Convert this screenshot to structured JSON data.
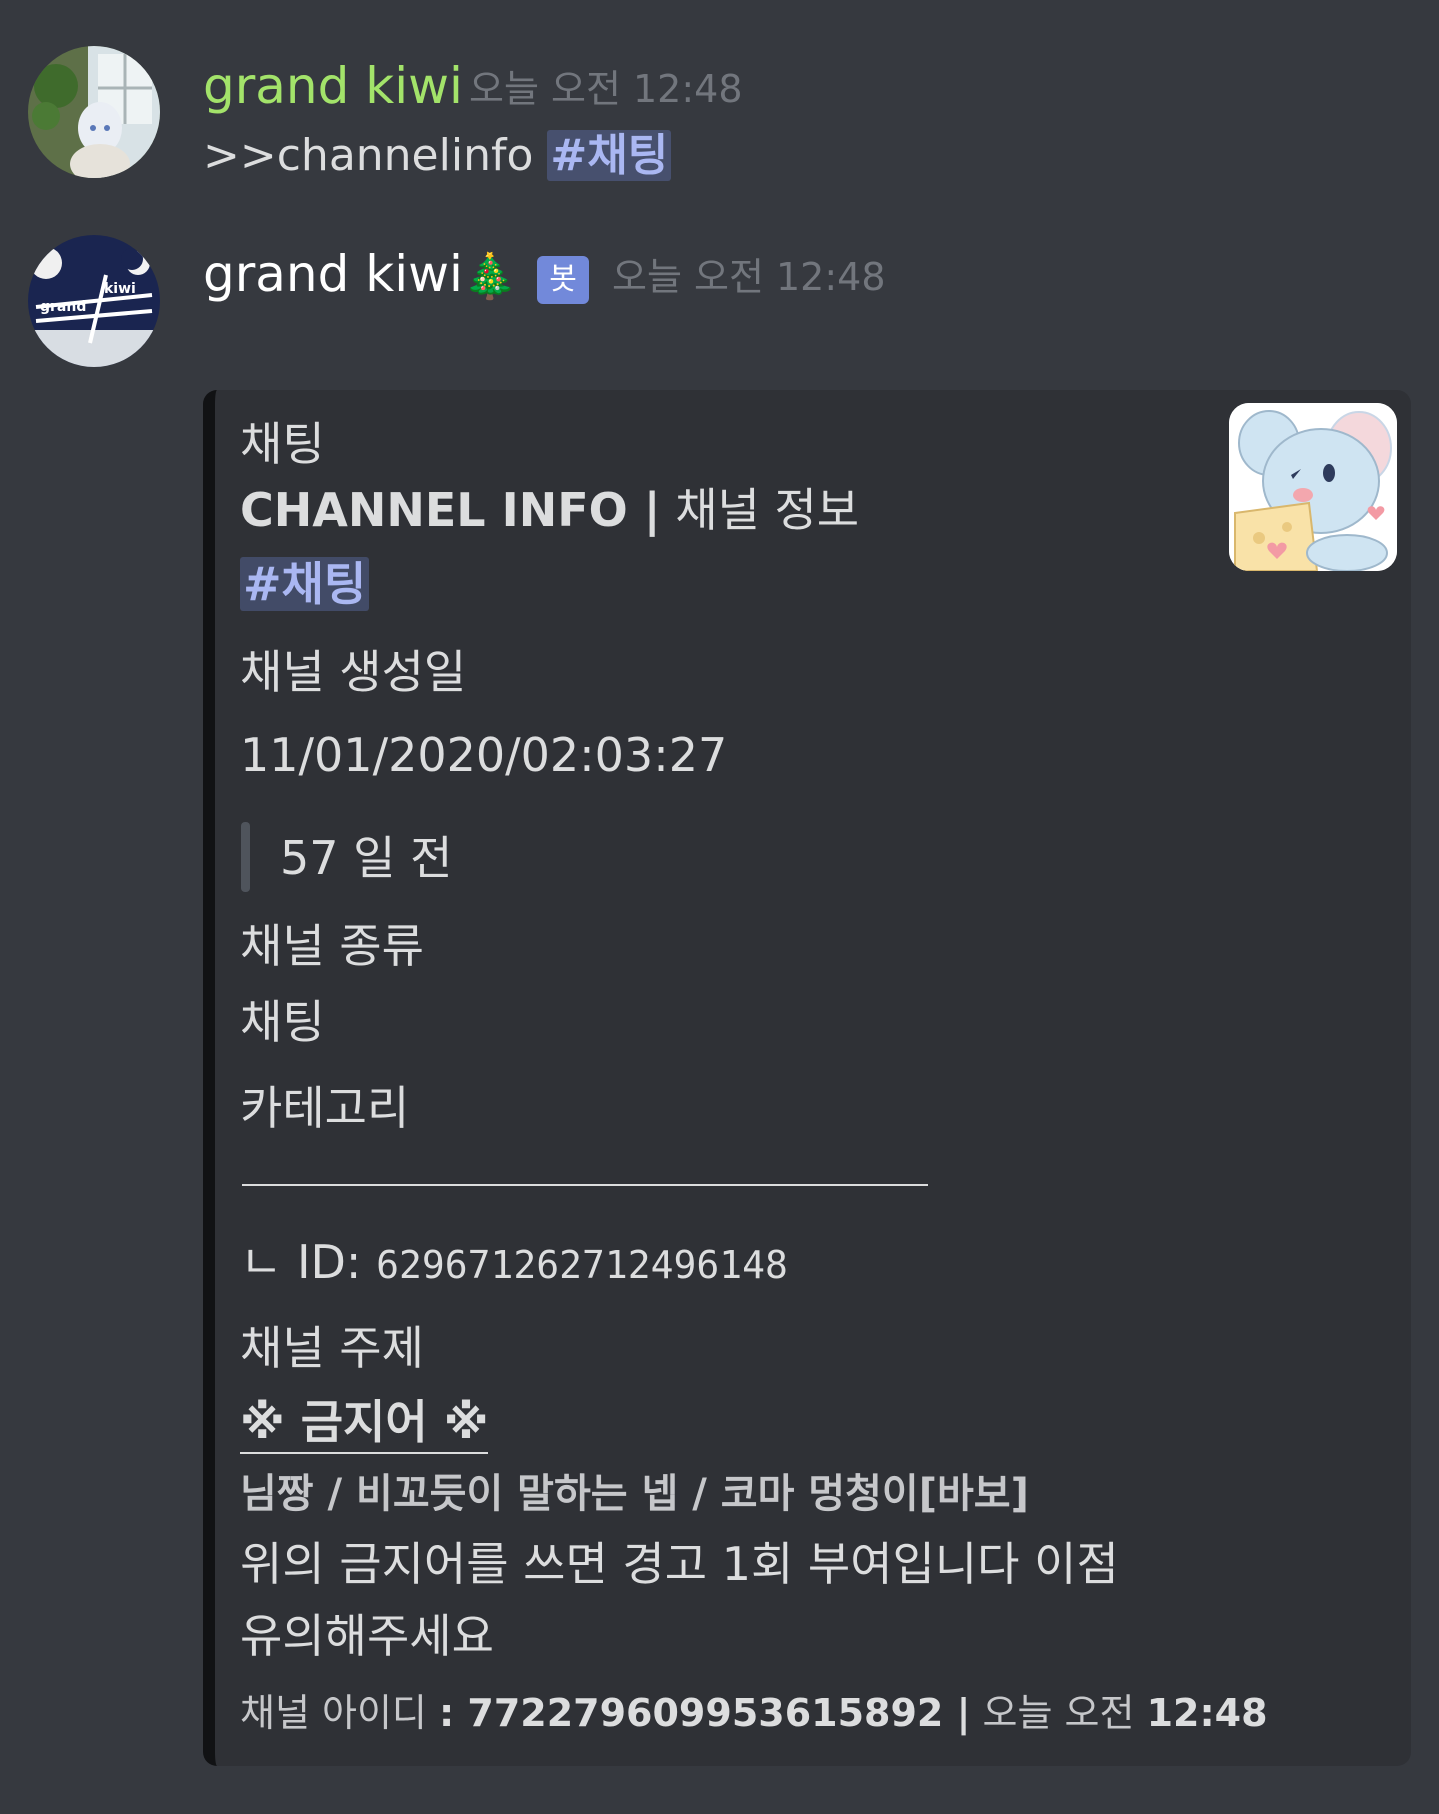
{
  "messages": [
    {
      "author": "grand kiwi",
      "author_color": "#a3e36a",
      "timestamp": "오늘 오전 12:48",
      "command": ">>channelinfo",
      "mention": "#채팅"
    },
    {
      "author": "grand kiwi",
      "author_emoji": "🎄",
      "bot_badge": "봇",
      "timestamp": "오늘 오전 12:48",
      "avatar_text_1": "grand",
      "avatar_text_2": "kiwi"
    }
  ],
  "embed": {
    "author": "채팅",
    "title_bold": "CHANNEL INFO |",
    "title_rest": "채널 정보",
    "mention": "#채팅",
    "fields": {
      "created_name": "채널 생성일",
      "created_value": "11/01/2020/02:03:27",
      "created_ago": "57 일 전",
      "type_name": "채널 종류",
      "type_value": "채팅",
      "category_name": "카테고리",
      "id_prefix": "ㄴ ID:",
      "id_value": "629671262712496148",
      "topic_name": "채널 주제",
      "topic_heading": "※ 금지어 ※",
      "banned_words": "님짱  /  비꼬듯이  말하는  넵  /  코마  멍청이[바보]",
      "warning_1": "위의 금지어를 쓰면 경고 1회 부여입니다 이점",
      "warning_2": "유의해주세요"
    },
    "footer_label": "채널 아이디",
    "footer_id": ": 772279609953615892 |",
    "footer_time_prefix": "오늘 오전",
    "footer_time": "12:48",
    "accent_color": "#111214"
  }
}
